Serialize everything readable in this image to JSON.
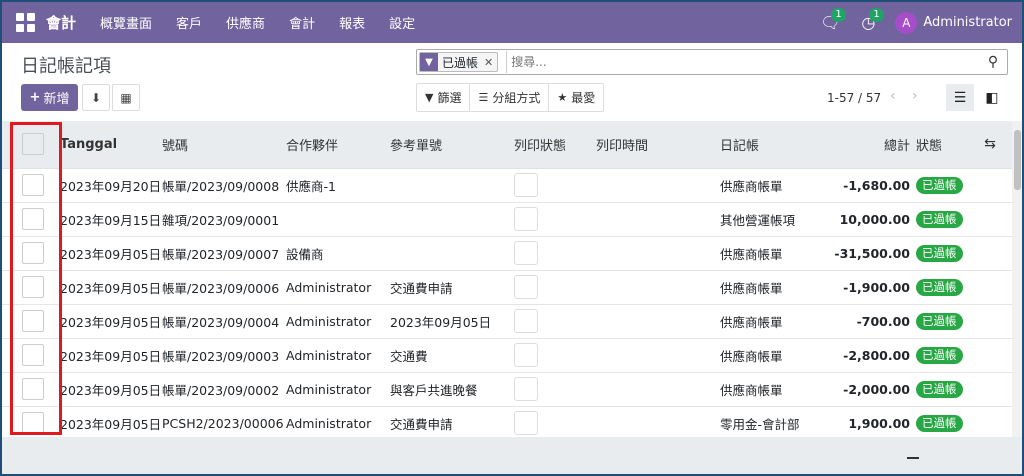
{
  "navbar": {
    "brand": "會計",
    "menu": [
      "概覽畫面",
      "客戶",
      "供應商",
      "會計",
      "報表",
      "設定"
    ],
    "messages_badge": "1",
    "activities_badge": "1",
    "avatar_letter": "A",
    "username": "Administrator",
    "accent_color": "#71639e"
  },
  "page": {
    "title": "日記帳記項",
    "new_button": "新增",
    "search": {
      "facet_label": "已過帳",
      "placeholder": "搜尋..."
    },
    "toolbar": {
      "filters": "篩選",
      "group_by": "分組方式",
      "favorites": "最愛"
    },
    "pager": "1-57 / 57"
  },
  "table": {
    "headers": {
      "date": "Tanggal",
      "number": "號碼",
      "partner": "合作夥伴",
      "ref": "參考單號",
      "print_status": "列印狀態",
      "print_time": "列印時間",
      "journal": "日記帳",
      "total": "總計",
      "status": "狀態"
    },
    "rows": [
      {
        "date": "2023年09月20日",
        "number": "帳單/2023/09/0008",
        "partner": "供應商-1",
        "ref": "",
        "journal": "供應商帳單",
        "total": "-1,680.00",
        "status": "已過帳"
      },
      {
        "date": "2023年09月15日",
        "number": "雜項/2023/09/0001",
        "partner": "",
        "ref": "",
        "journal": "其他營運帳項",
        "total": "10,000.00",
        "status": "已過帳"
      },
      {
        "date": "2023年09月05日",
        "number": "帳單/2023/09/0007",
        "partner": "設備商",
        "ref": "",
        "journal": "供應商帳單",
        "total": "-31,500.00",
        "status": "已過帳"
      },
      {
        "date": "2023年09月05日",
        "number": "帳單/2023/09/0006",
        "partner": "Administrator",
        "ref": "交通費申請",
        "journal": "供應商帳單",
        "total": "-1,900.00",
        "status": "已過帳"
      },
      {
        "date": "2023年09月05日",
        "number": "帳單/2023/09/0004",
        "partner": "Administrator",
        "ref": "2023年09月05日",
        "journal": "供應商帳單",
        "total": "-700.00",
        "status": "已過帳"
      },
      {
        "date": "2023年09月05日",
        "number": "帳單/2023/09/0003",
        "partner": "Administrator",
        "ref": "交通費",
        "journal": "供應商帳單",
        "total": "-2,800.00",
        "status": "已過帳"
      },
      {
        "date": "2023年09月05日",
        "number": "帳單/2023/09/0002",
        "partner": "Administrator",
        "ref": "與客戶共進晚餐",
        "journal": "供應商帳單",
        "total": "-2,000.00",
        "status": "已過帳"
      },
      {
        "date": "2023年09月05日",
        "number": "PCSH2/2023/00006",
        "partner": "Administrator",
        "ref": "交通費申請",
        "journal": "零用金-會計部",
        "total": "1,900.00",
        "status": "已過帳"
      }
    ]
  }
}
